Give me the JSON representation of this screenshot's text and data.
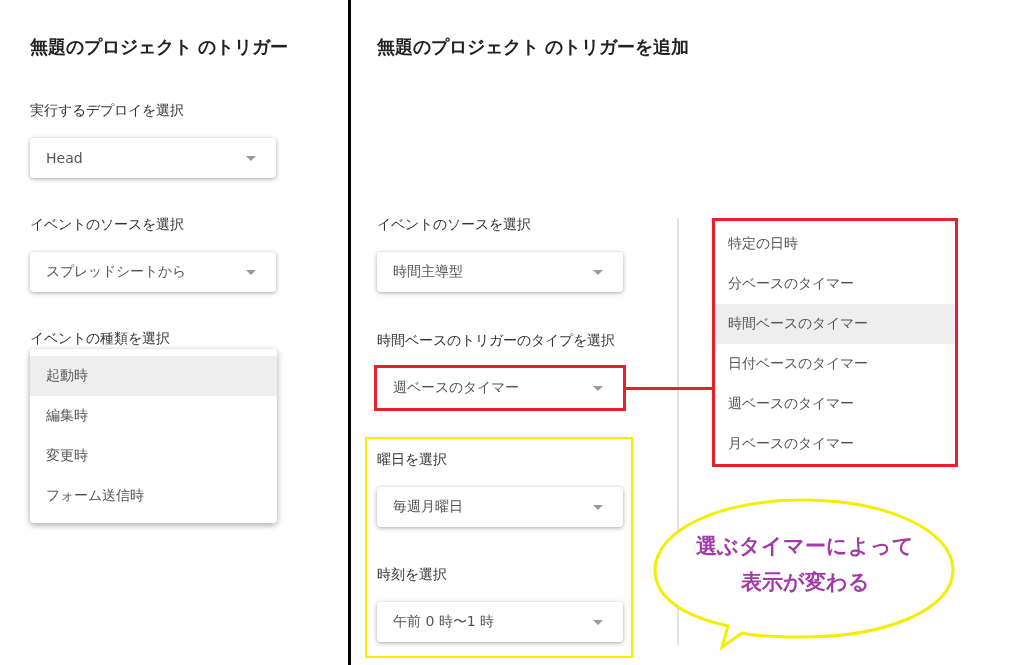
{
  "left_panel": {
    "title": "無題のプロジェクト のトリガー",
    "fields": [
      {
        "label": "実行するデプロイを選択",
        "value": "Head"
      },
      {
        "label": "イベントのソースを選択",
        "value": "スプレッドシートから"
      },
      {
        "label": "イベントの種類を選択",
        "menu": [
          {
            "label": "起動時",
            "selected": true
          },
          {
            "label": "編集時",
            "selected": false
          },
          {
            "label": "変更時",
            "selected": false
          },
          {
            "label": "フォーム送信時",
            "selected": false
          }
        ]
      }
    ]
  },
  "right_panel": {
    "title": "無題のプロジェクト のトリガーを追加",
    "fields": [
      {
        "label": "イベントのソースを選択",
        "value": "時間主導型",
        "kind": "plain"
      },
      {
        "label": "時間ベースのトリガーのタイプを選択",
        "value": "週ベースのタイマー",
        "kind": "boxed"
      }
    ],
    "highlighted_fields": [
      {
        "label": "曜日を選択",
        "value": "毎週月曜日"
      },
      {
        "label": "時刻を選択",
        "value": "午前 0 時〜1 時"
      }
    ],
    "open_menu": [
      {
        "label": "特定の日時",
        "selected": false
      },
      {
        "label": "分ベースのタイマー",
        "selected": false
      },
      {
        "label": "時間ベースのタイマー",
        "selected": true
      },
      {
        "label": "日付ベースのタイマー",
        "selected": false
      },
      {
        "label": "週ベースのタイマー",
        "selected": false
      },
      {
        "label": "月ベースのタイマー",
        "selected": false
      }
    ]
  },
  "callout": {
    "lines": [
      "選ぶタイマーによって",
      "表示が変わる"
    ]
  }
}
